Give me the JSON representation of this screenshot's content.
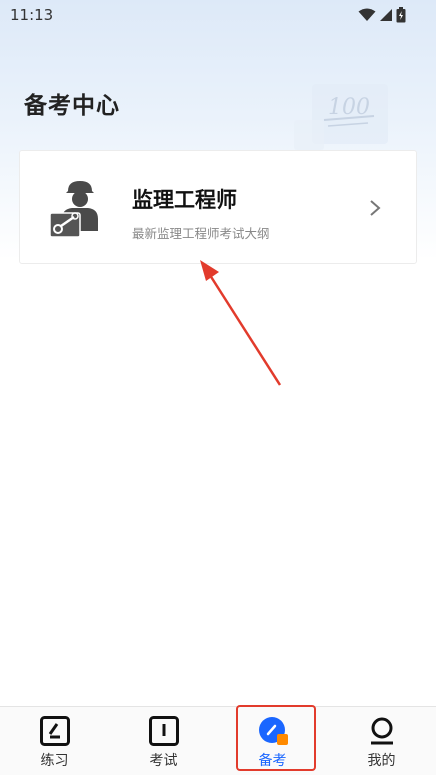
{
  "status_bar": {
    "time": "11:13",
    "icons": [
      "wifi-icon",
      "signal-icon",
      "battery-icon"
    ]
  },
  "header": {
    "title": "备考中心",
    "decoration_text": "100"
  },
  "card": {
    "title": "监理工程师",
    "subtitle": "最新监理工程师考试大纲",
    "icon": "engineer-icon"
  },
  "tabbar": {
    "items": [
      {
        "label": "练习",
        "icon": "practice-icon"
      },
      {
        "label": "考试",
        "icon": "exam-icon"
      },
      {
        "label": "备考",
        "icon": "prepare-icon"
      },
      {
        "label": "我的",
        "icon": "profile-icon"
      }
    ],
    "active_index": 2
  },
  "colors": {
    "accent": "#1a66ff",
    "accent_secondary": "#ff8a00",
    "annotation": "#e23b2c"
  }
}
